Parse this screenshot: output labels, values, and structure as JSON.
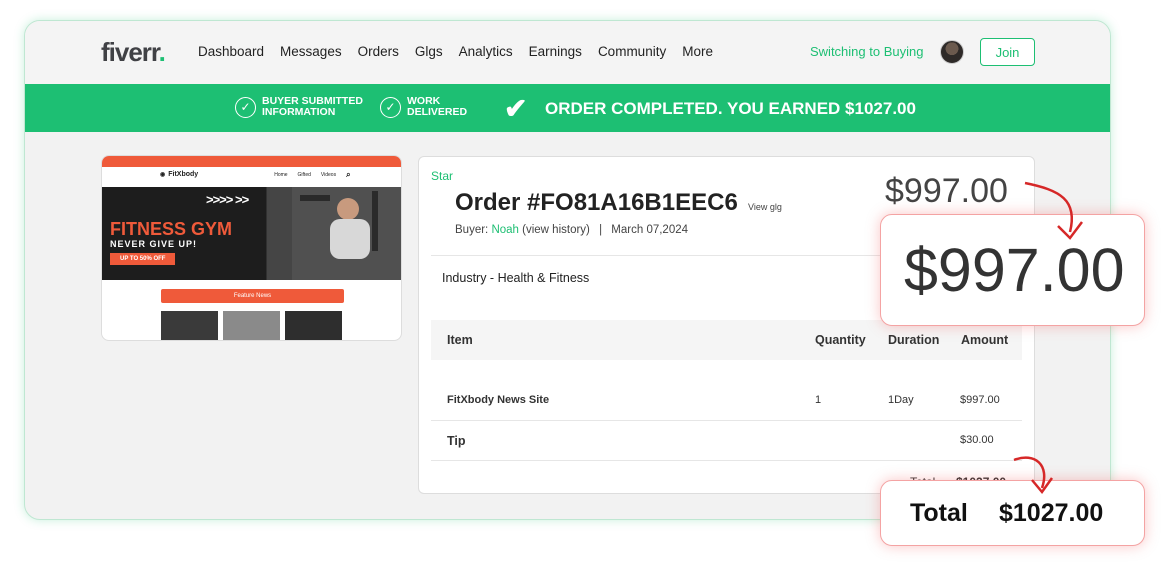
{
  "nav": {
    "logo_text": "fiverr",
    "logo_dot": ".",
    "links": [
      "Dashboard",
      "Messages",
      "Orders",
      "Glgs",
      "Analytics",
      "Earnings",
      "Community",
      "More"
    ],
    "switch_label": "Switching to Buying",
    "join_label": "Join"
  },
  "banner": {
    "step1_line1": "BUYER SUBMITTED",
    "step1_line2": "INFORMATION",
    "step2_line1": "WORK",
    "step2_line2": "DELIVERED",
    "completed_text": "ORDER COMPLETED. YOU EARNED $1027.00",
    "check_icon": "✔",
    "step_check_icon": "✓"
  },
  "thumbnail": {
    "brand": "FitXbody",
    "menu": [
      "Home",
      "Gifted",
      "Videos"
    ],
    "hero_title": "FITNESS GYM",
    "hero_subtitle": "NEVER GIVE UP!",
    "hero_button": "UP TO 50% OFF",
    "chevrons": ">>>> >>",
    "feature_label": "Feature News"
  },
  "order": {
    "level": "Star",
    "title": "Order #FO81A16B1EEC6",
    "view_gig": "View glg",
    "buyer_label": "Buyer:",
    "buyer_name": "Noah",
    "view_history": "(view history)",
    "separator": "|",
    "date": "March 07,2024",
    "price": "$997.00",
    "industry": "Industry - Health & Fitness"
  },
  "table": {
    "headers": {
      "item": "Item",
      "quantity": "Quantity",
      "duration": "Duration",
      "amount": "Amount"
    },
    "row1": {
      "item": "FitXbody News Site",
      "quantity": "1",
      "duration": "1Day",
      "amount": "$997.00"
    },
    "row2": {
      "item": "Tip",
      "amount": "$30.00"
    },
    "total_label": "Total",
    "total_value": "$1027.00"
  },
  "callouts": {
    "price": "$997.00",
    "total_label": "Total",
    "total_value": "$1027.00"
  },
  "colors": {
    "accent": "#1dbf73",
    "callout_arrow": "#d62828"
  }
}
